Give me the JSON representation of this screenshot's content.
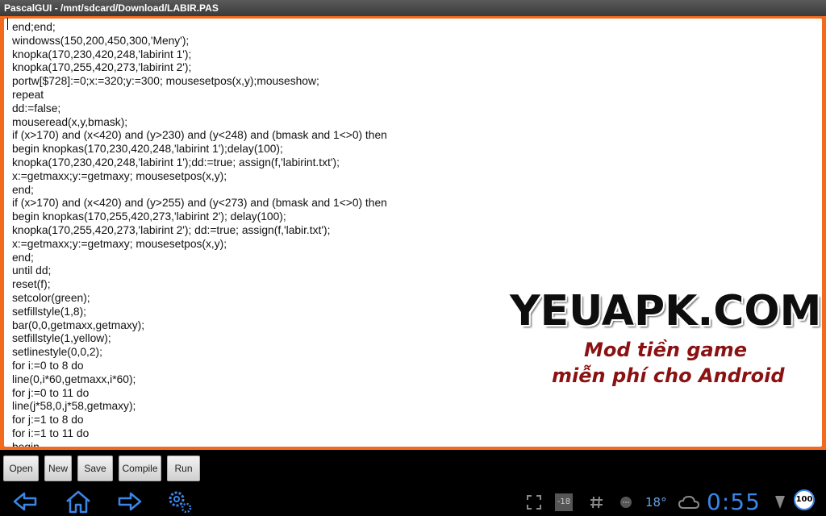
{
  "window": {
    "title": "PascalGUI - /mnt/sdcard/Download/LABIR.PAS"
  },
  "editor": {
    "lines": [
      "end;end;",
      "windowss(150,200,450,300,'Meny');",
      "knopka(170,230,420,248,'labirint 1');",
      "knopka(170,255,420,273,'labirint 2');",
      "portw[$728]:=0;x:=320;y:=300; mousesetpos(x,y);mouseshow;",
      "repeat",
      "dd:=false;",
      "mouseread(x,y,bmask);",
      "if (x>170) and (x<420) and (y>230) and (y<248) and (bmask and 1<>0) then",
      "begin knopkas(170,230,420,248,'labirint 1');delay(100);",
      "knopka(170,230,420,248,'labirint 1');dd:=true; assign(f,'labirint.txt');",
      "x:=getmaxx;y:=getmaxy; mousesetpos(x,y);",
      "end;",
      "if (x>170) and (x<420) and (y>255) and (y<273) and (bmask and 1<>0) then",
      "begin knopkas(170,255,420,273,'labirint 2'); delay(100);",
      "knopka(170,255,420,273,'labirint 2'); dd:=true; assign(f,'labir.txt');",
      "x:=getmaxx;y:=getmaxy; mousesetpos(x,y);",
      "end;",
      "until dd;",
      "reset(f);",
      "setcolor(green);",
      "setfillstyle(1,8);",
      "bar(0,0,getmaxx,getmaxy);",
      "setfillstyle(1,yellow);",
      "setlinestyle(0,0,2);",
      "for i:=0 to 8 do",
      "line(0,i*60,getmaxx,i*60);",
      "for j:=0 to 11 do",
      "line(j*58,0,j*58,getmaxy);",
      "for j:=1 to 8 do",
      "for i:=1 to 11 do",
      "begin"
    ]
  },
  "watermark": {
    "title": "YEUAPK.COM",
    "line1": "Mod tiền game",
    "line2": "miễn phí cho Android"
  },
  "toolbar": {
    "open": "Open",
    "new": "New",
    "save": "Save",
    "compile": "Compile",
    "run": "Run"
  },
  "statusbar": {
    "temperature": "18°",
    "clock": "0:55",
    "battery": "100",
    "badge_18": "-18"
  },
  "icons": {
    "back": "back-arrow-icon",
    "home": "home-icon",
    "forward": "forward-arrow-icon",
    "settings": "settings-gears-icon"
  },
  "colors": {
    "frame": "#f26a1b",
    "accent": "#3a86e8"
  }
}
